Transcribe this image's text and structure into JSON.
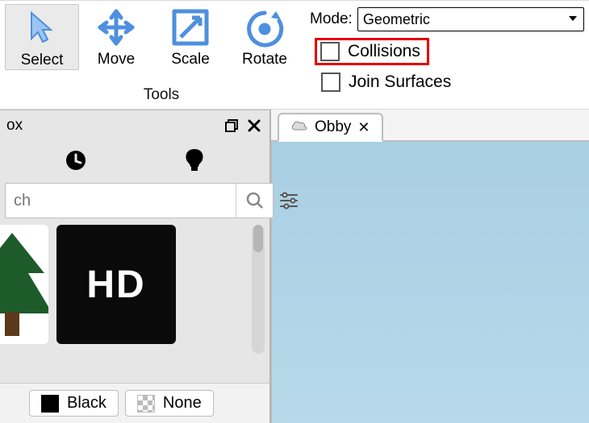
{
  "ribbon": {
    "tools": {
      "select": "Select",
      "move": "Move",
      "scale": "Scale",
      "rotate": "Rotate",
      "group_label": "Tools"
    },
    "mode_label": "Mode:",
    "mode_value": "Geometric",
    "collisions_label": "Collisions",
    "join_surfaces_label": "Join Surfaces"
  },
  "toolbox": {
    "title_fragment": "ox",
    "search_placeholder": "ch",
    "hd_label": "HD",
    "chips": {
      "black": "Black",
      "none": "None"
    }
  },
  "tabs": {
    "obby": "Obby",
    "close_glyph": "✕"
  }
}
